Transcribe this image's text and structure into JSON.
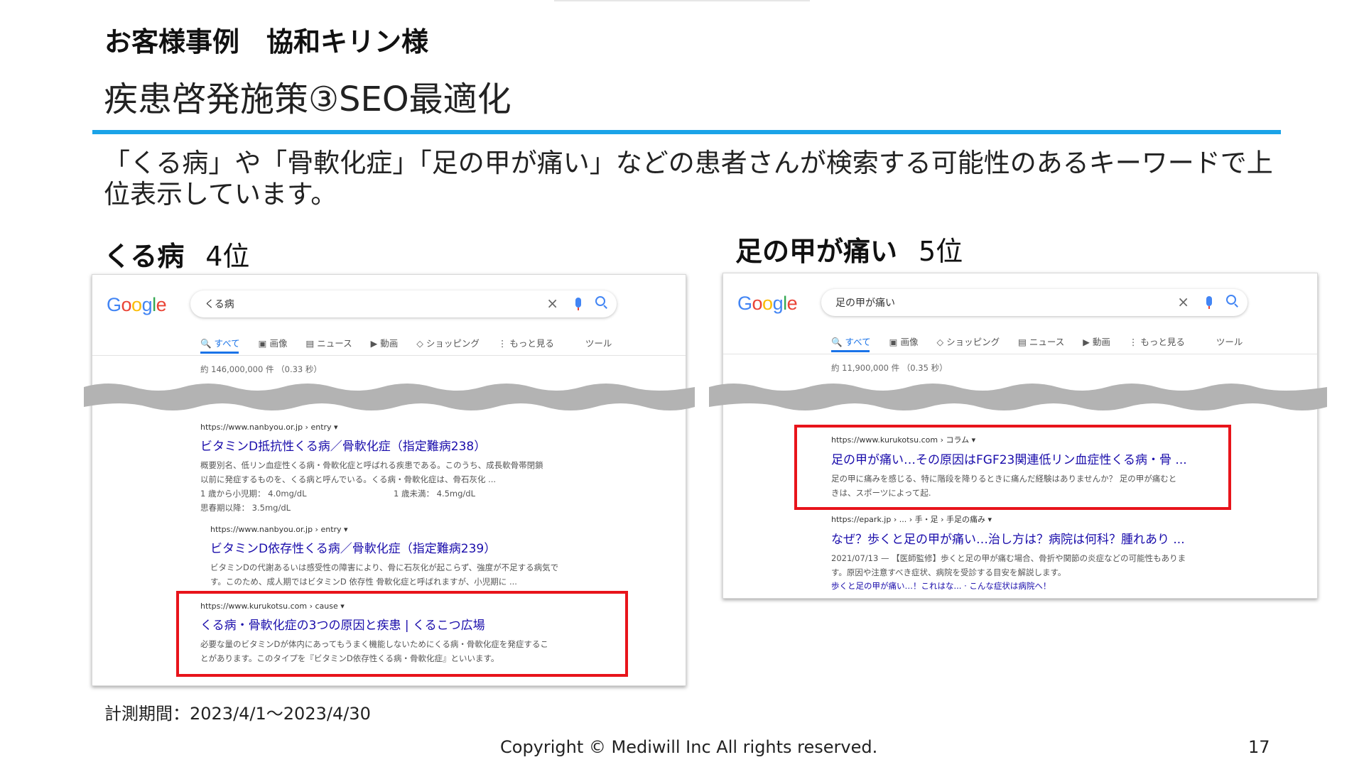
{
  "header": {
    "case_title": "お客様事例　協和キリン様",
    "slide_title": "疾患啓発施策③SEO最適化"
  },
  "lead_text": "「くる病」や「骨軟化症」「足の甲が痛い」などの患者さんが検索する可能性のあるキーワードで上位表示しています。",
  "colors": {
    "accent_rule": "#1aa3e8",
    "highlight_box": "#e8141b",
    "link": "#1a0dab"
  },
  "left_example": {
    "keyword": "くる病",
    "rank": "4位",
    "google_logo": "Google",
    "query": "くる病",
    "tabs": [
      "すべて",
      "画像",
      "ニュース",
      "動画",
      "ショッピング",
      "もっと見る",
      "ツール"
    ],
    "result_count": "約 146,000,000 件 （0.33 秒）",
    "results": [
      {
        "url": "https://www.nanbyou.or.jp › entry ▾",
        "title": "ビタミンD抵抗性くる病／骨軟化症（指定難病238）",
        "snippet_1": "概要別名、低リン血症性くる病・骨軟化症と呼ばれる疾患である。このうち、成長軟骨帯閉鎖",
        "snippet_2": "以前に発症するものを、くる病と呼んでいる。くる病・骨軟化症は、骨石灰化 ...",
        "data_1a": "1 歳から小児期： 4.0mg/dL",
        "data_1b": "1 歳未満： 4.5mg/dL",
        "data_2": "思春期以降： 3.5mg/dL"
      },
      {
        "url": "https://www.nanbyou.or.jp › entry ▾",
        "title": "ビタミンD依存性くる病／骨軟化症（指定難病239）",
        "snippet_1": "ビタミンDの代謝あるいは感受性の障害により、骨に石灰化が起こらず、強度が不足する病気で",
        "snippet_2": "す。このため、成人期ではビタミンD 依存性 骨軟化症と呼ばれますが、小児期に ..."
      },
      {
        "url": "https://www.kurukotsu.com › cause ▾",
        "title": "くる病・骨軟化症の3つの原因と疾患 | くるこつ広場",
        "snippet_1": "必要な量のビタミンDが体内にあってもうまく機能しないためにくる病・骨軟化症を発症するこ",
        "snippet_2": "とがあります。このタイプを『ビタミンD依存性くる病・骨軟化症』といいます。"
      }
    ]
  },
  "right_example": {
    "keyword": "足の甲が痛い",
    "rank": "5位",
    "google_logo": "Google",
    "query": "足の甲が痛い",
    "tabs": [
      "すべて",
      "画像",
      "ショッピング",
      "ニュース",
      "動画",
      "もっと見る",
      "ツール"
    ],
    "result_count": "約 11,900,000 件 （0.35 秒）",
    "results": [
      {
        "url": "https://www.kurukotsu.com › コラム ▾",
        "title": "足の甲が痛い…その原因はFGF23関連低リン血症性くる病・骨 ...",
        "snippet_1": "足の甲に痛みを感じる、特に階段を降りるときに痛んだ経験はありませんか？ 足の甲が痛むと",
        "snippet_2": "きは、スポーツによって起."
      },
      {
        "url": "https://epark.jp › ... › 手・足 › 手足の痛み ▾",
        "title": "なぜ？歩くと足の甲が痛い…治し方は？病院は何科？腫れあり ...",
        "snippet_1": "2021/07/13 — 【医師監修】歩くと足の甲が痛む場合、骨折や関節の炎症などの可能性もありま",
        "snippet_2": "す。原因や注意すべき症状、病院を受診する目安を解説します。",
        "sublinks": "歩くと足の甲が痛い…！これはな... · こんな症状は病院へ！"
      }
    ]
  },
  "footer": {
    "period": "計測期間：2023/4/1～2023/4/30",
    "copyright": "Copyright © Mediwill Inc All rights reserved.",
    "page_number": "17"
  }
}
